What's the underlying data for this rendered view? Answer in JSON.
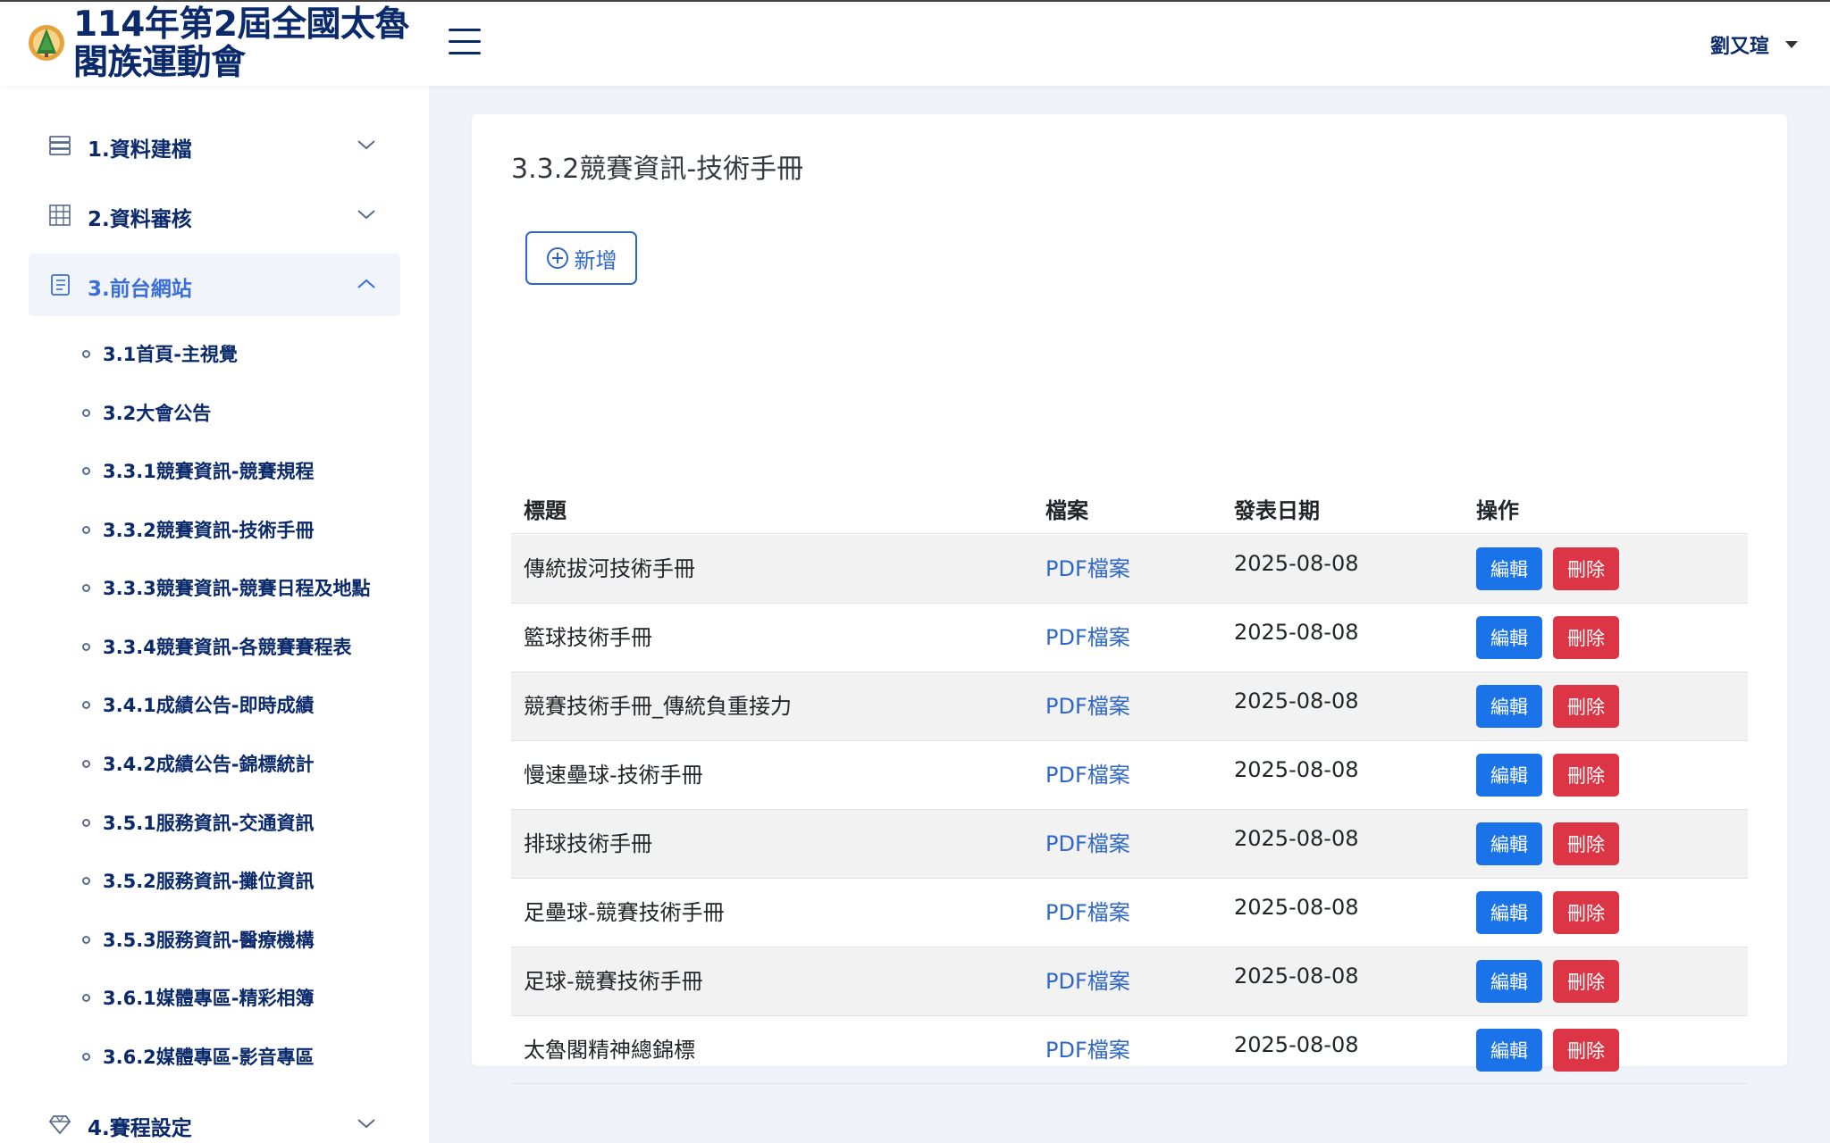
{
  "header": {
    "title": "114年第2屆全國太魯閣族運動會",
    "title_line1": "114年第2屆全國太魯",
    "title_line2": "閣族運動會",
    "user_name": "劉又瑄"
  },
  "sidebar": {
    "sections": [
      {
        "label": "1.資料建檔",
        "icon": "database-icon",
        "expanded": false
      },
      {
        "label": "2.資料審核",
        "icon": "grid-icon",
        "expanded": false
      },
      {
        "label": "3.前台網站",
        "icon": "document-icon",
        "expanded": true
      },
      {
        "label": "4.賽程設定",
        "icon": "diamond-icon",
        "expanded": false
      }
    ],
    "sub_items": [
      "3.1首頁-主視覺",
      "3.2大會公告",
      "3.3.1競賽資訊-競賽規程",
      "3.3.2競賽資訊-技術手冊",
      "3.3.3競賽資訊-競賽日程及地點",
      "3.3.4競賽資訊-各競賽賽程表",
      "3.4.1成績公告-即時成績",
      "3.4.2成績公告-錦標統計",
      "3.5.1服務資訊-交通資訊",
      "3.5.2服務資訊-攤位資訊",
      "3.5.3服務資訊-醫療機構",
      "3.6.1媒體專區-精彩相簿",
      "3.6.2媒體專區-影音專區"
    ]
  },
  "main": {
    "page_title": "3.3.2競賽資訊-技術手冊",
    "add_label": "新增",
    "table": {
      "headers": [
        "標題",
        "檔案",
        "發表日期",
        "操作"
      ],
      "rows": [
        {
          "title": "傳統拔河技術手冊",
          "file": "PDF檔案",
          "date": "2025-08-08"
        },
        {
          "title": "籃球技術手冊",
          "file": "PDF檔案",
          "date": "2025-08-08"
        },
        {
          "title": "競賽技術手冊_傳統負重接力",
          "file": "PDF檔案",
          "date": "2025-08-08"
        },
        {
          "title": "慢速壘球-技術手冊",
          "file": "PDF檔案",
          "date": "2025-08-08"
        },
        {
          "title": "排球技術手冊",
          "file": "PDF檔案",
          "date": "2025-08-08"
        },
        {
          "title": "足壘球-競賽技術手冊",
          "file": "PDF檔案",
          "date": "2025-08-08"
        },
        {
          "title": "足球-競賽技術手冊",
          "file": "PDF檔案",
          "date": "2025-08-08"
        },
        {
          "title": "太魯閣精神總錦標",
          "file": "PDF檔案",
          "date": "2025-08-08"
        }
      ],
      "edit_label": "編輯",
      "delete_label": "刪除"
    }
  },
  "colors": {
    "brand": "#0b2a6b",
    "primary": "#1a73e8",
    "danger": "#dc3545",
    "link": "#2f67c8"
  }
}
